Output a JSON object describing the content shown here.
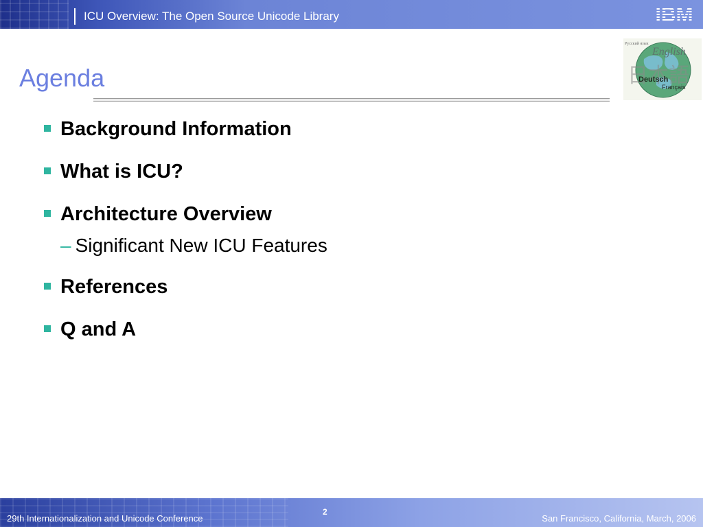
{
  "header": {
    "title": "ICU Overview: The Open Source Unicode Library",
    "logo_text": "IBM"
  },
  "slide": {
    "title": "Agenda",
    "bullets": [
      {
        "label": "Background Information"
      },
      {
        "label": "What is ICU?"
      },
      {
        "label": "Architecture Overview",
        "sub": "Significant New ICU Features"
      },
      {
        "label": "References"
      },
      {
        "label": "Q and A"
      }
    ]
  },
  "globe": {
    "labels": [
      "Русский язык",
      "English",
      "日本語",
      "Deutsch",
      "Français"
    ]
  },
  "footer": {
    "left": "29th Internationalization and Unicode Conference",
    "page_number": "2",
    "right": "San Francisco, California, March, 2006"
  },
  "colors": {
    "accent": "#2fb5a0",
    "title": "#6b7fe0",
    "header": "#6c84d6"
  }
}
